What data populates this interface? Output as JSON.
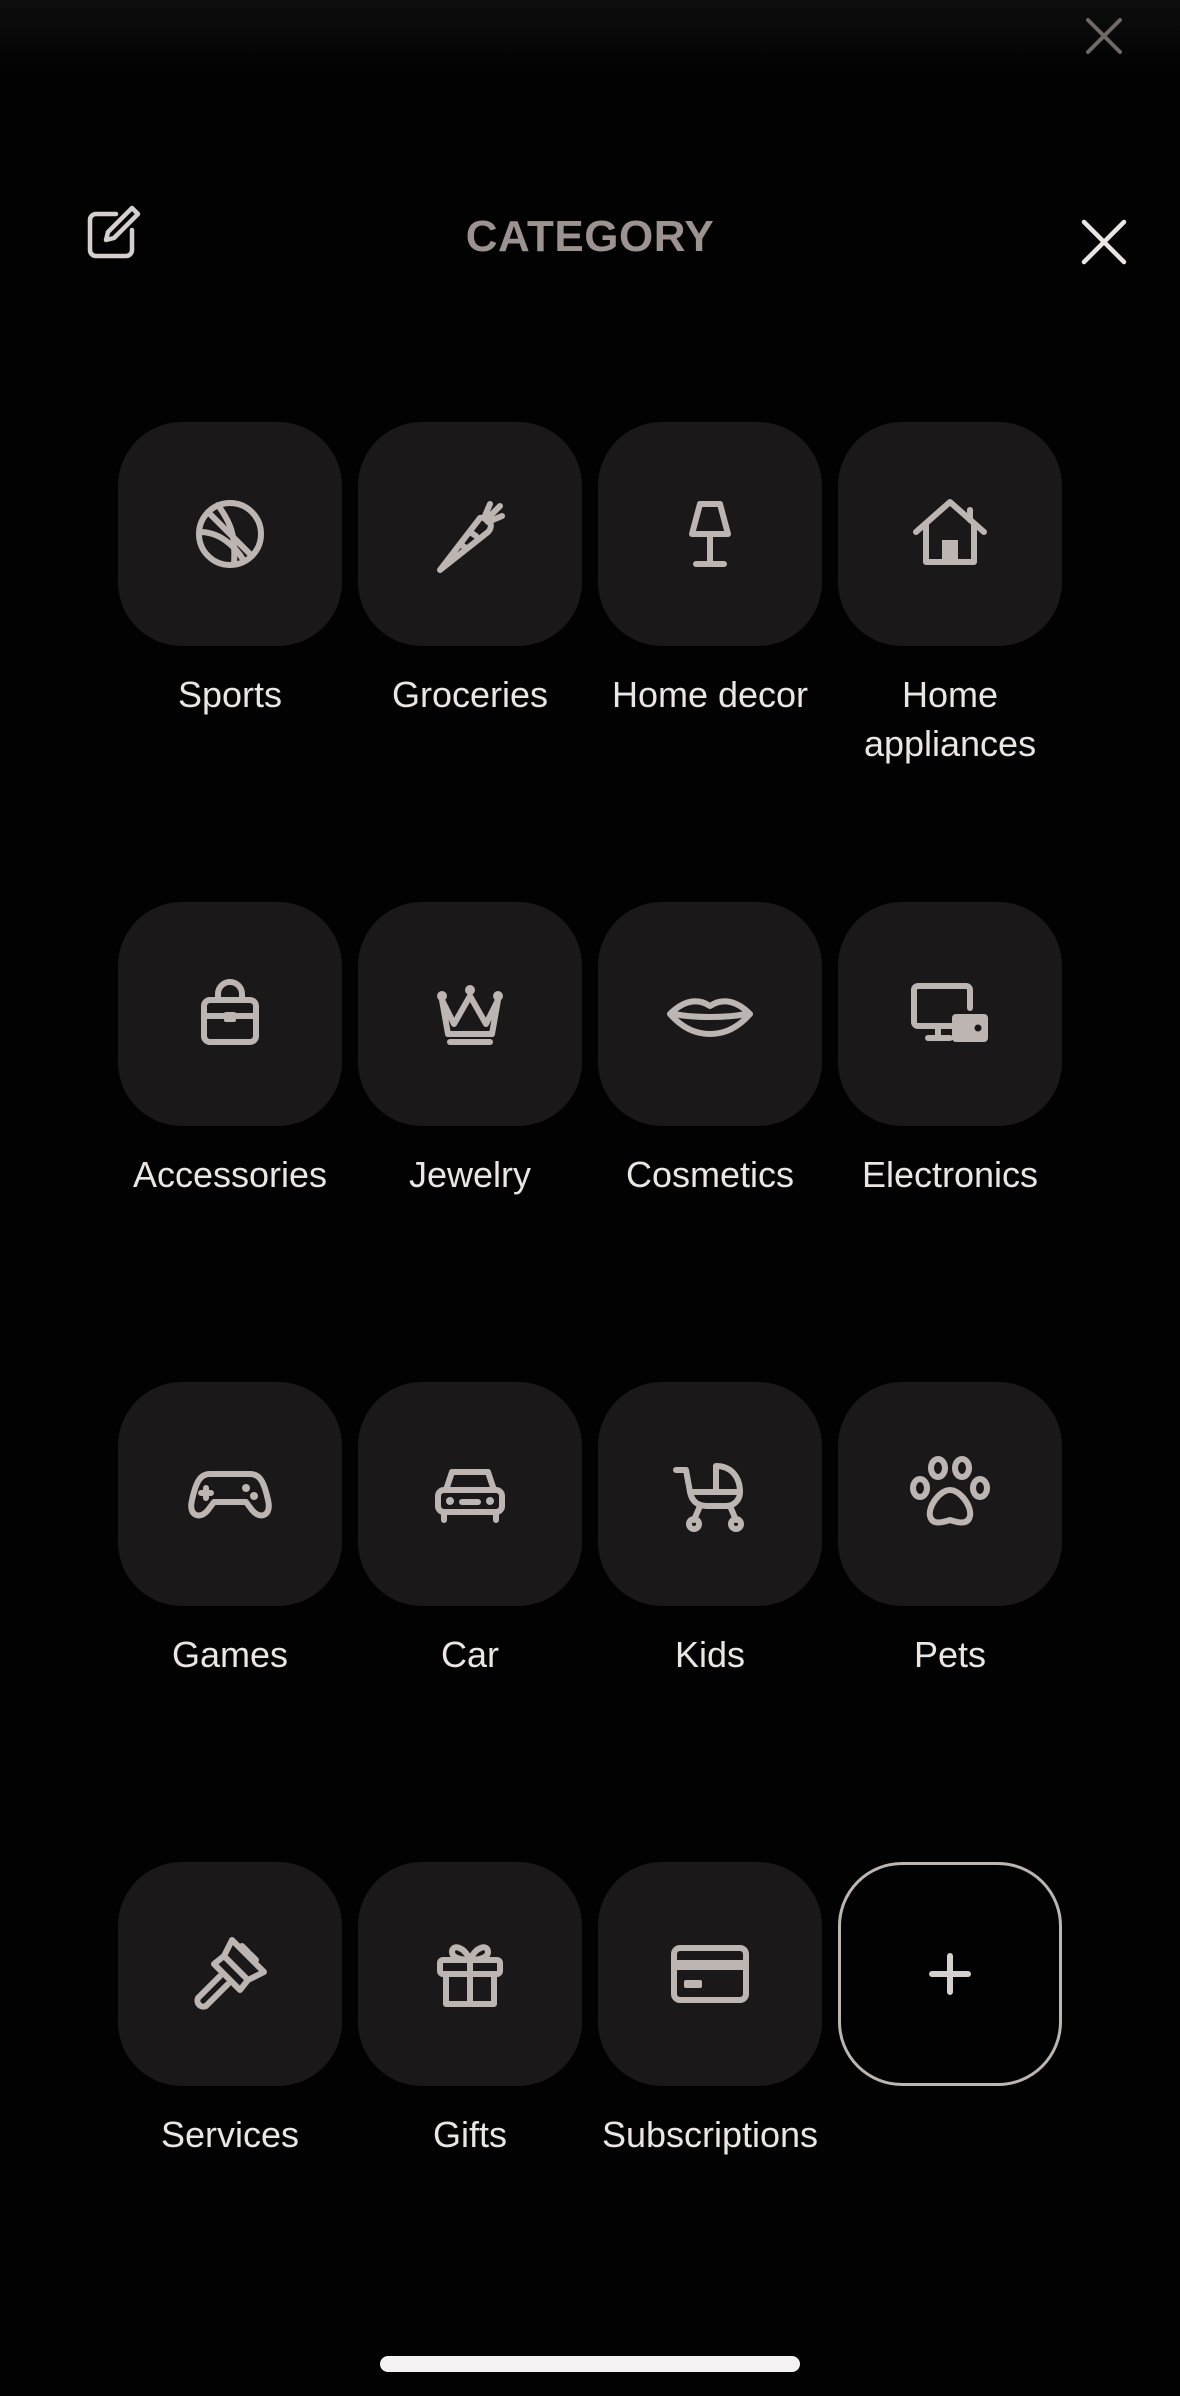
{
  "header": {
    "title": "CATEGORY"
  },
  "categories": [
    {
      "label": "Sports",
      "icon": "basketball-icon"
    },
    {
      "label": "Groceries",
      "icon": "carrot-icon"
    },
    {
      "label": "Home decor",
      "icon": "lamp-icon"
    },
    {
      "label": "Home appliances",
      "icon": "house-icon"
    },
    {
      "label": "Accessories",
      "icon": "handbag-icon"
    },
    {
      "label": "Jewelry",
      "icon": "crown-icon"
    },
    {
      "label": "Cosmetics",
      "icon": "lips-icon"
    },
    {
      "label": "Electronics",
      "icon": "devices-icon"
    },
    {
      "label": "Games",
      "icon": "gamepad-icon"
    },
    {
      "label": "Car",
      "icon": "car-icon"
    },
    {
      "label": "Kids",
      "icon": "stroller-icon"
    },
    {
      "label": "Pets",
      "icon": "paw-icon"
    },
    {
      "label": "Services",
      "icon": "paintbrush-icon"
    },
    {
      "label": "Gifts",
      "icon": "gift-icon"
    },
    {
      "label": "Subscriptions",
      "icon": "credit-card-icon"
    }
  ],
  "add_button": {
    "icon": "plus-icon"
  },
  "colors": {
    "background": "#030203",
    "tile": "#1a1819",
    "icon": "#bdb5b2",
    "label": "#ece6e3",
    "title": "#9c9391"
  }
}
